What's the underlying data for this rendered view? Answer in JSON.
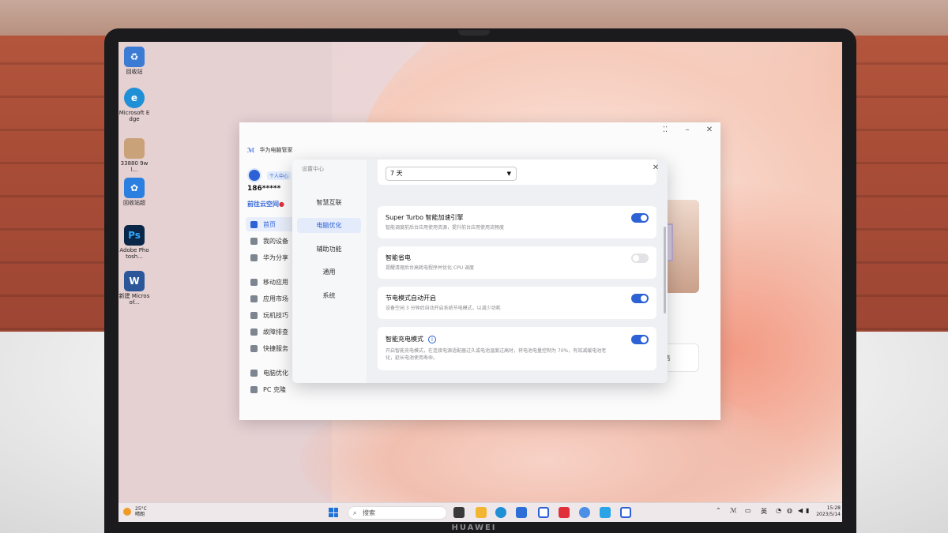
{
  "desktop": {
    "icons": [
      {
        "label": "回收站",
        "icon": "recycle-bin-icon",
        "color": "#3b7bd4"
      },
      {
        "label": "Microsoft Edge",
        "icon": "edge-icon",
        "color": "#1f8fd6"
      },
      {
        "label": "33880 9wl...",
        "icon": "image-file-icon",
        "color": "#caa27a"
      },
      {
        "label": "回收站超",
        "icon": "huawei-app-icon",
        "color": "#2a7fe0"
      },
      {
        "label": "Adobe Photosh...",
        "icon": "photoshop-icon",
        "color": "#0b2747",
        "glyph": "Ps"
      },
      {
        "label": "新建 Microsof...",
        "icon": "word-icon",
        "color": "#2b579a",
        "glyph": "W"
      }
    ]
  },
  "app": {
    "brand_logo": "ℳ",
    "name": "华为电脑管家",
    "controls": {
      "snap": "⁚⁚",
      "minimize": "–",
      "close": "✕"
    },
    "user": {
      "badge": "个人中心",
      "phone": "186*****",
      "cloud_link": "前往云空间",
      "cloud_dot": "●"
    },
    "sidebar": [
      {
        "label": "首页",
        "active": true
      },
      {
        "label": "我的设备",
        "active": false
      },
      {
        "label": "华为分享",
        "active": false
      },
      {
        "label": "移动应用",
        "active": false
      },
      {
        "label": "应用市场",
        "active": false
      },
      {
        "label": "玩机技巧",
        "active": false
      },
      {
        "label": "故障排查",
        "active": false
      },
      {
        "label": "快捷服务",
        "active": false
      },
      {
        "label": "电脑优化",
        "active": false
      },
      {
        "label": "PC 克隆",
        "active": false
      }
    ],
    "card_fragment": "售"
  },
  "dialog": {
    "title": "设置中心",
    "close": "✕",
    "nav": [
      {
        "label": "智慧互联",
        "active": false
      },
      {
        "label": "电脑优化",
        "active": true
      },
      {
        "label": "辅助功能",
        "active": false
      },
      {
        "label": "通用",
        "active": false
      },
      {
        "label": "系统",
        "active": false
      }
    ],
    "select": {
      "value": "7 天",
      "caret": "▼"
    },
    "settings": [
      {
        "title": "Super Turbo 智能加速引擎",
        "desc": "智能调度前后台应用使用资源，提升前台应用使用流畅度",
        "on": true
      },
      {
        "title": "智能省电",
        "desc": "提醒清理后台高耗电程序并优化 CPU 调度",
        "on": false
      },
      {
        "title": "节电模式自动开启",
        "desc": "设备空闲 3 分钟后自动开启系统节电模式，以减少功耗",
        "on": true
      },
      {
        "title": "智能充电模式",
        "desc": "开启智能充电模式，在连接电源适配器过久或电池温度过高时，将电池电量控制为 70%，有效减缓电池老化，延长电池使用寿命。",
        "on": true,
        "info": "i"
      }
    ]
  },
  "taskbar": {
    "weather": {
      "temp": "25°C",
      "condition": "晴朗"
    },
    "search_placeholder": "搜索",
    "search_glyph": "⌕",
    "apps": [
      {
        "icon": "task-view-icon",
        "color": "#3a3a3a"
      },
      {
        "icon": "file-explorer-icon",
        "color": "#f2b632"
      },
      {
        "icon": "edge-icon",
        "color": "#1f8fd6"
      },
      {
        "icon": "store-icon",
        "color": "#2d6fd6"
      },
      {
        "icon": "pc-manager-icon",
        "color": "#2c5fd8"
      },
      {
        "icon": "app-gallery-icon",
        "color": "#e0303a"
      },
      {
        "icon": "cloud-icon",
        "color": "#4b8fe6"
      },
      {
        "icon": "share-icon",
        "color": "#2aa4e6"
      },
      {
        "icon": "pc-manager-tray-icon",
        "color": "#2c5fd8"
      }
    ],
    "tray": [
      {
        "label": "⌃",
        "icon": "chevron-up-icon"
      },
      {
        "label": "ℳ",
        "icon": "pc-manager-tray-icon"
      },
      {
        "label": "▭",
        "icon": "touchpad-icon"
      },
      {
        "label": "英",
        "icon": "ime-icon"
      },
      {
        "label": "◔",
        "icon": "network-icon"
      },
      {
        "label": "◍",
        "icon": "wifi-icon"
      },
      {
        "label": "◀",
        "icon": "volume-icon"
      },
      {
        "label": "▮",
        "icon": "battery-icon"
      }
    ],
    "time": "15:28",
    "date": "2023/5/14"
  },
  "device": {
    "brand": "HUAWEI"
  }
}
